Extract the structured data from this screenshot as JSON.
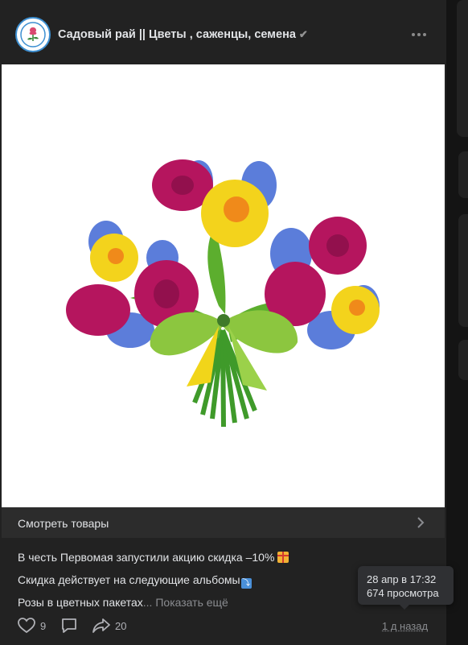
{
  "post": {
    "community_name": "Садовый рай || Цветы , саженцы, семена",
    "verified_icon": "verified-check-icon",
    "more_icon": "more-dots-icon",
    "image_alt": "bouquet-illustration",
    "goods_bar": {
      "label": "Смотреть товары"
    },
    "text": {
      "line1": "В честь Первомая запустили акцию скидка –10%",
      "line2": "Скидка действует на следующие альбомы",
      "line3_text": "Розы в цветных пакетах",
      "line3_ellipsis": "...",
      "show_more": "Показать ещё"
    },
    "actions": {
      "likes": "9",
      "comments": "",
      "shares": "20"
    },
    "time_ago": "1 д назад",
    "tooltip": {
      "date": "28 апр в 17:32",
      "views": "674 просмотра"
    }
  },
  "colors": {
    "background": "#141414",
    "card": "#222222",
    "goods_bar": "#2c2c2c",
    "text": "#e1e3e6",
    "muted": "#8a8c90"
  }
}
